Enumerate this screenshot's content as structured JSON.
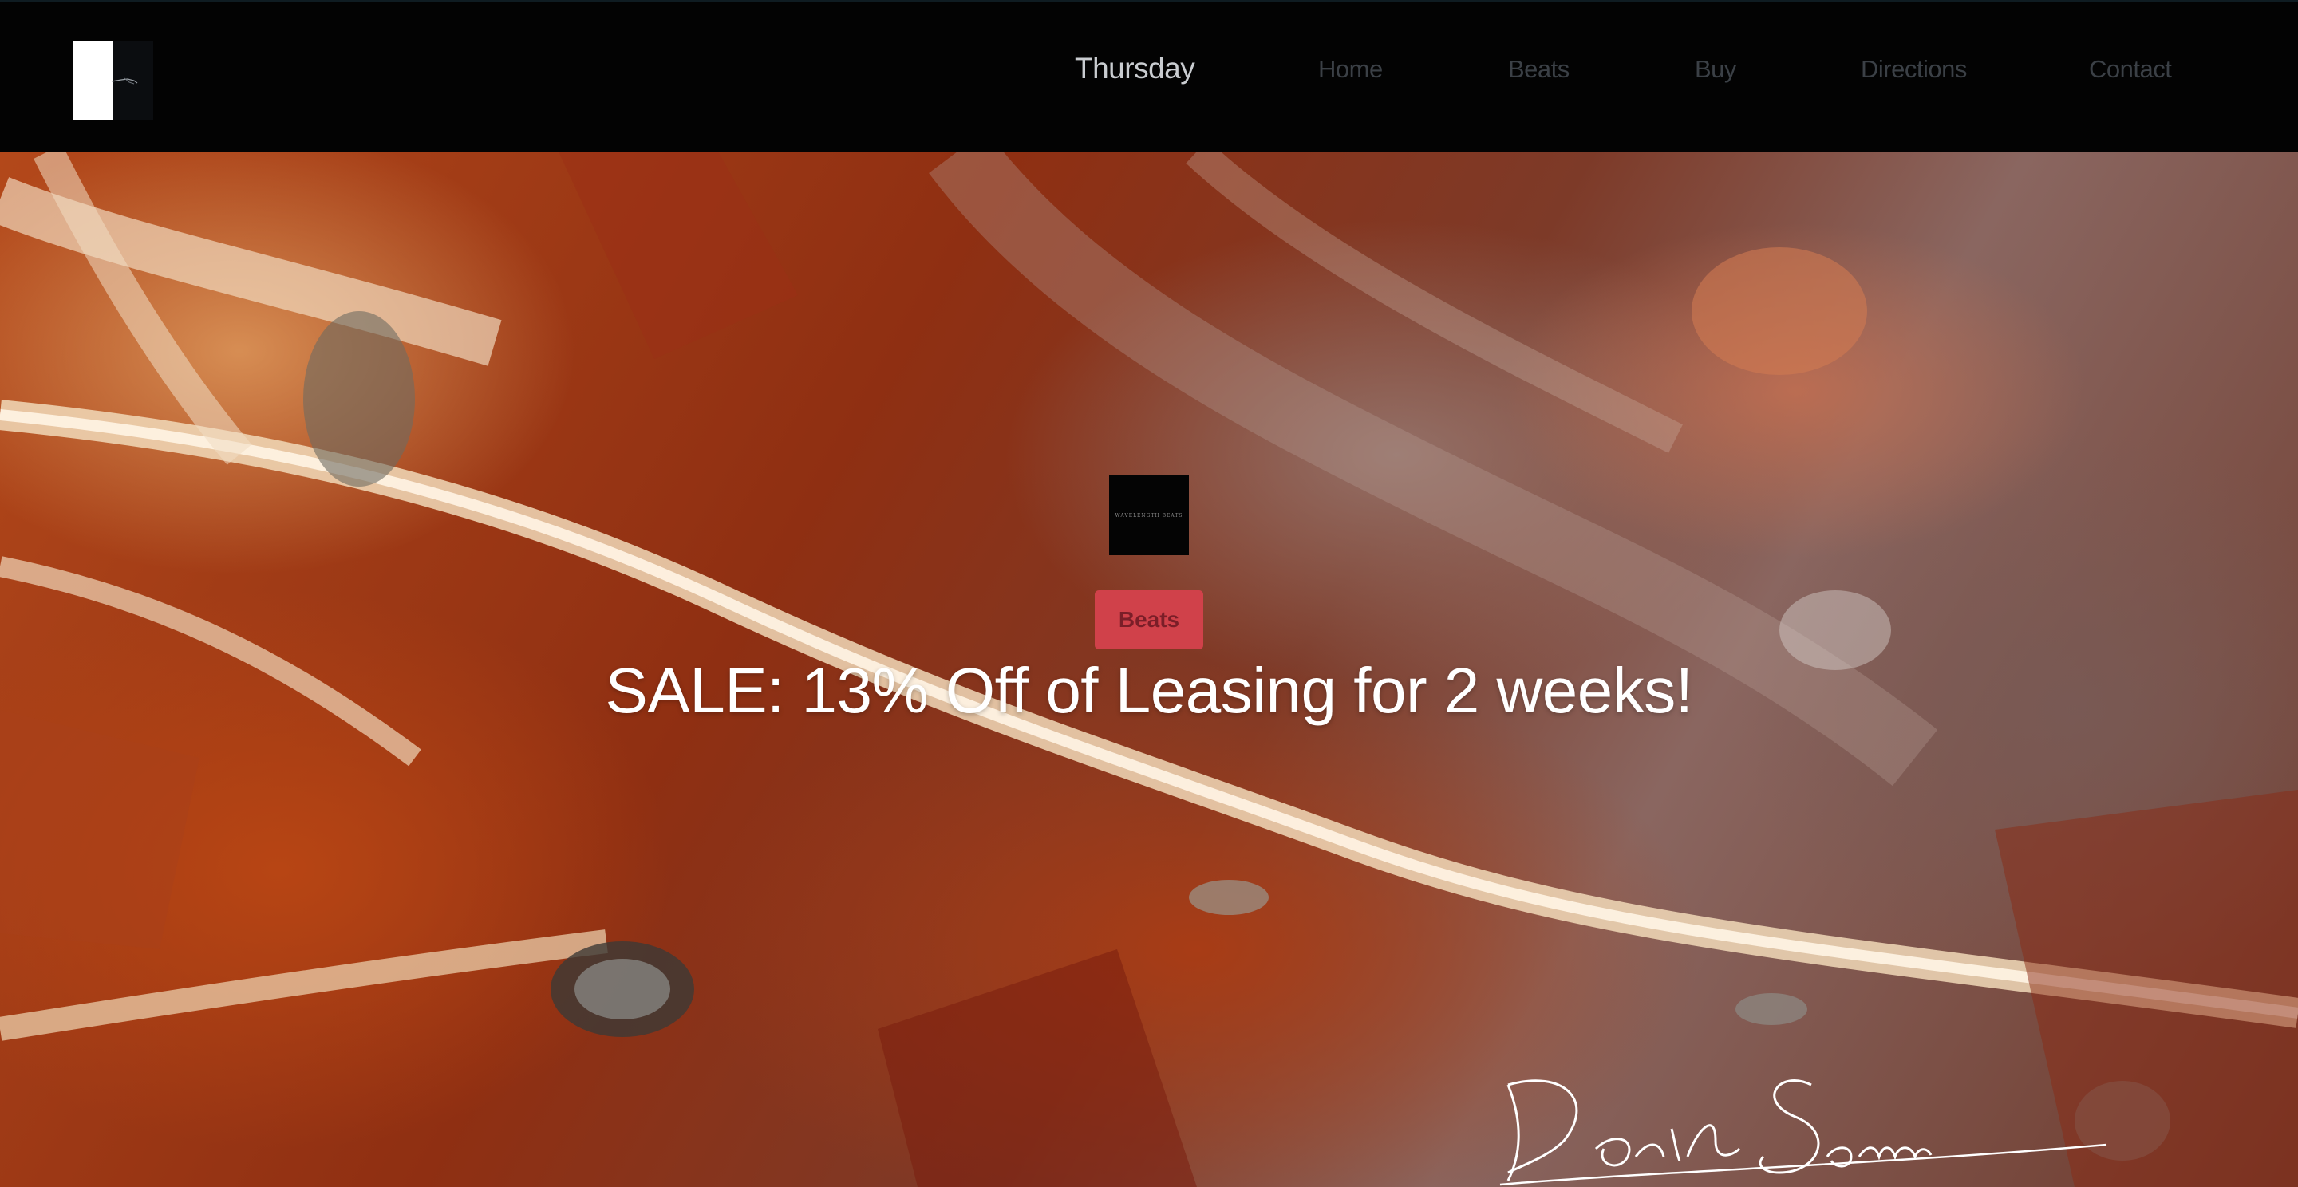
{
  "header": {
    "site_title": "Thursday",
    "nav": [
      {
        "label": "Home"
      },
      {
        "label": "Beats"
      },
      {
        "label": "Buy"
      },
      {
        "label": "Directions"
      },
      {
        "label": "Contact"
      }
    ]
  },
  "hero": {
    "button_label": "Beats",
    "headline": "SALE: 13% Off of Leasing for 2 weeks!"
  },
  "colors": {
    "header_bg": "#030303",
    "button_bg": "#d0414a",
    "headline_text": "#ffffff"
  },
  "icons": {
    "logo": "site-logo-icon",
    "brand_mark": "brand-mark-icon",
    "signature": "signature-image"
  }
}
